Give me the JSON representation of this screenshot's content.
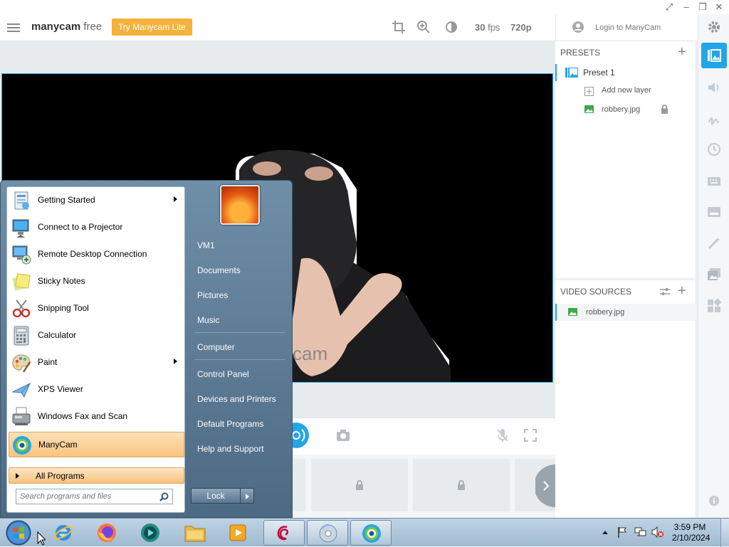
{
  "app": {
    "logo_bold": "manycam",
    "logo_rest": " free",
    "try_button": "Try Manycam Lite",
    "fps_value": "30",
    "fps_unit": " fps",
    "resolution": "720p",
    "login_label": "Login to ManyCam",
    "watermark": "ycam",
    "accent_color": "#21a6e6",
    "try_color": "#f5b13c"
  },
  "presets": {
    "header": "PRESETS",
    "preset_name": "Preset 1",
    "add_layer": "Add new layer",
    "layer_file": "robbery.jpg"
  },
  "video_sources": {
    "header": "VIDEO SOURCES",
    "source_file": "robbery.jpg"
  },
  "start_menu": {
    "programs": [
      {
        "label": "Getting Started",
        "icon": "getting-started-icon",
        "submenu": true
      },
      {
        "label": "Connect to a Projector",
        "icon": "projector-icon",
        "submenu": false
      },
      {
        "label": "Remote Desktop Connection",
        "icon": "remote-desktop-icon",
        "submenu": false
      },
      {
        "label": "Sticky Notes",
        "icon": "sticky-notes-icon",
        "submenu": false
      },
      {
        "label": "Snipping Tool",
        "icon": "scissors-icon",
        "submenu": false
      },
      {
        "label": "Calculator",
        "icon": "calculator-icon",
        "submenu": false
      },
      {
        "label": "Paint",
        "icon": "palette-icon",
        "submenu": true
      },
      {
        "label": "XPS Viewer",
        "icon": "xps-viewer-icon",
        "submenu": false
      },
      {
        "label": "Windows Fax and Scan",
        "icon": "fax-icon",
        "submenu": false
      },
      {
        "label": "ManyCam",
        "icon": "manycam-icon",
        "submenu": false
      }
    ],
    "all_programs": "All Programs",
    "search_placeholder": "Search programs and files",
    "right_links": [
      "VM1",
      "Documents",
      "Pictures",
      "Music",
      "Computer",
      "Control Panel",
      "Devices and Printers",
      "Default Programs",
      "Help and Support"
    ],
    "lock_label": "Lock"
  },
  "taskbar": {
    "time": "3:59 PM",
    "date": "2/10/2024"
  }
}
